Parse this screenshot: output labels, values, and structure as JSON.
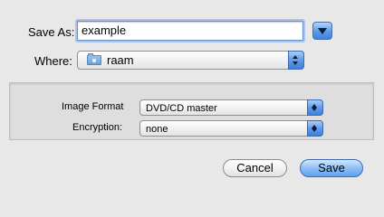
{
  "save_as": {
    "label": "Save As:",
    "value": "example"
  },
  "where": {
    "label": "Where:",
    "selected": "raam",
    "icon": "folder-icon"
  },
  "options": {
    "image_format": {
      "label": "Image Format",
      "selected": "DVD/CD master"
    },
    "encryption": {
      "label": "Encryption:",
      "selected": "none"
    }
  },
  "buttons": {
    "cancel": "Cancel",
    "save": "Save"
  },
  "colors": {
    "accent": "#5f9de9",
    "focus_ring": "#a8c4ee"
  }
}
